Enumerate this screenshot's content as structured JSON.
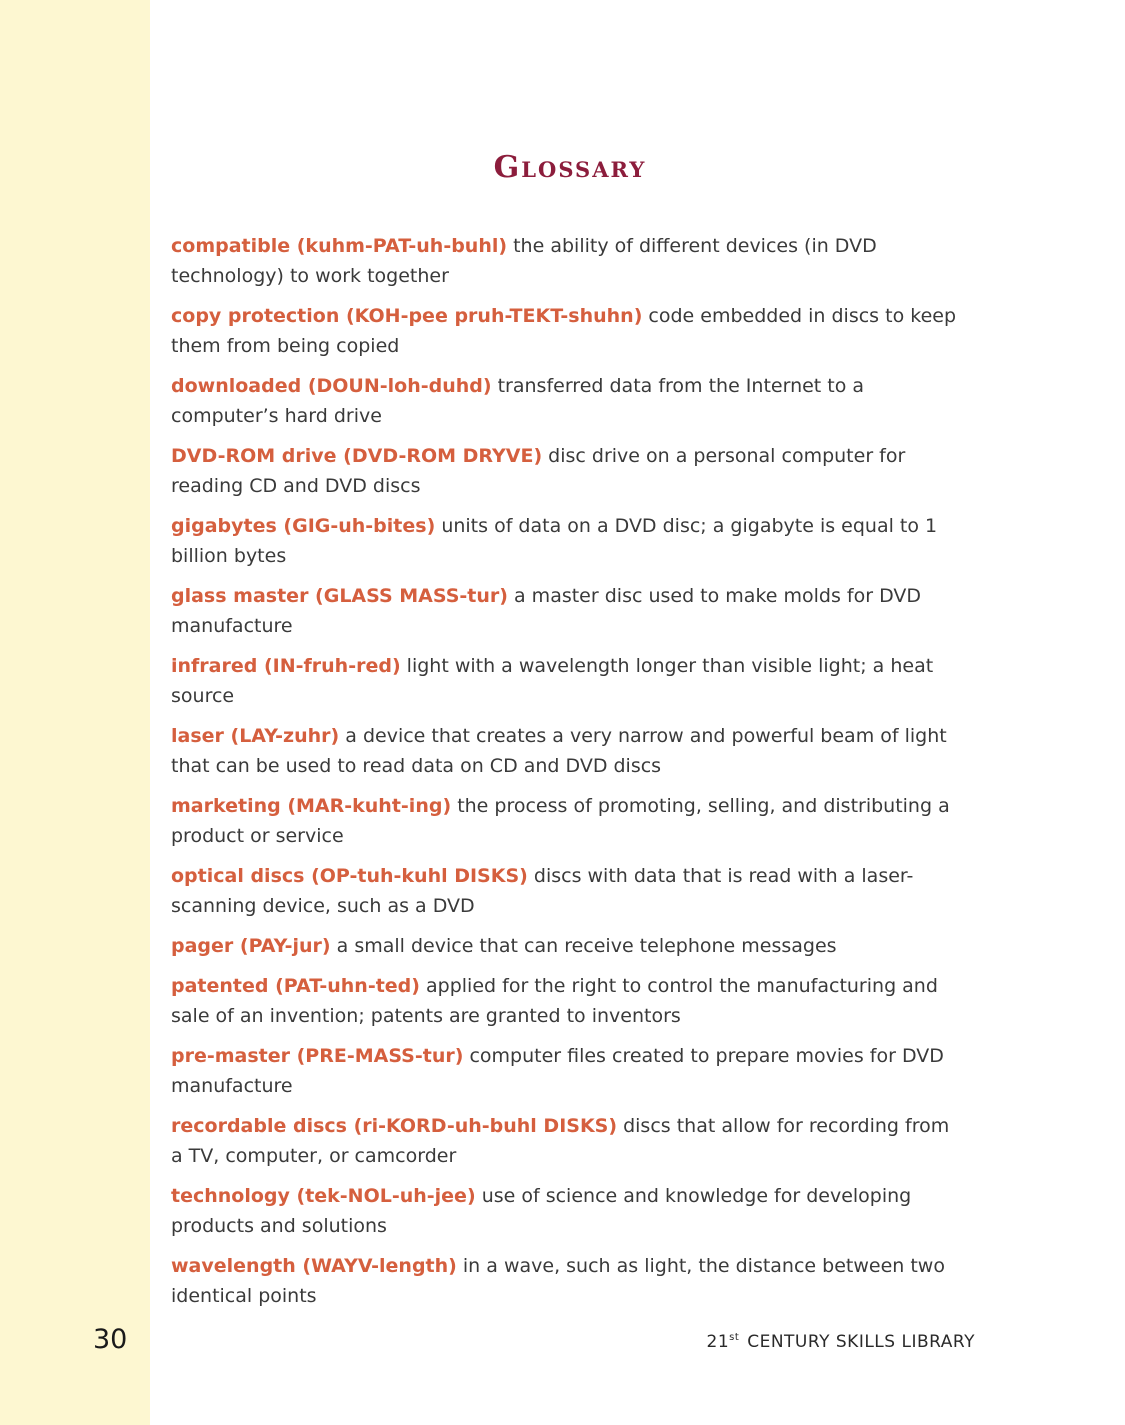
{
  "page": {
    "title": "Glossary",
    "page_number": "30",
    "footer": {
      "number": "21",
      "superscript": "st",
      "text": "CENTURY SKILLS LIBRARY"
    }
  },
  "colors": {
    "margin_strip": "#fdf7d1",
    "title": "#8c1d3c",
    "term": "#d55f3e"
  },
  "entries": [
    {
      "term": "compatible (kuhm-PAT-uh-buhl)",
      "definition": "the ability of different devices (in DVD technology) to work together"
    },
    {
      "term": "copy protection (KOH-pee pruh-TEKT-shuhn)",
      "definition": "code embedded in discs to keep them from being copied"
    },
    {
      "term": "downloaded (DOUN-loh-duhd)",
      "definition": "transferred data from the Internet to a computer’s hard drive"
    },
    {
      "term": "DVD-ROM drive (DVD-ROM DRYVE)",
      "definition": "disc drive on a personal computer for reading CD and DVD discs"
    },
    {
      "term": "gigabytes (GIG-uh-bites)",
      "definition": "units of data on a DVD disc; a gigabyte is equal to 1 billion bytes"
    },
    {
      "term": "glass master (GLASS MASS-tur)",
      "definition": "a master disc used to make molds for DVD manufacture"
    },
    {
      "term": "infrared (IN-fruh-red)",
      "definition": "light with a wavelength longer than visible light; a heat source"
    },
    {
      "term": "laser (LAY-zuhr)",
      "definition": "a device that creates a very narrow and powerful beam of light that can be used to read data on CD and DVD discs"
    },
    {
      "term": "marketing (MAR-kuht-ing)",
      "definition": "the process of promoting, selling, and distributing a product or service"
    },
    {
      "term": "optical discs (OP-tuh-kuhl DISKS)",
      "definition": "discs with data that is read with a laser-scanning device, such as a DVD"
    },
    {
      "term": "pager (PAY-jur)",
      "definition": "a small device that can receive telephone messages"
    },
    {
      "term": "patented (PAT-uhn-ted)",
      "definition": "applied for the right to control the manufacturing and sale of an invention; patents are granted to inventors"
    },
    {
      "term": "pre-master (PRE-MASS-tur)",
      "definition": "computer files created to prepare movies for DVD manufacture"
    },
    {
      "term": "recordable discs (ri-KORD-uh-buhl DISKS)",
      "definition": "discs that allow for recording from a TV, computer, or camcorder"
    },
    {
      "term": "technology (tek-NOL-uh-jee)",
      "definition": "use of science and knowledge for developing products and solutions"
    },
    {
      "term": "wavelength (WAYV-length)",
      "definition": "in a wave, such as light, the distance between two identical points"
    }
  ]
}
